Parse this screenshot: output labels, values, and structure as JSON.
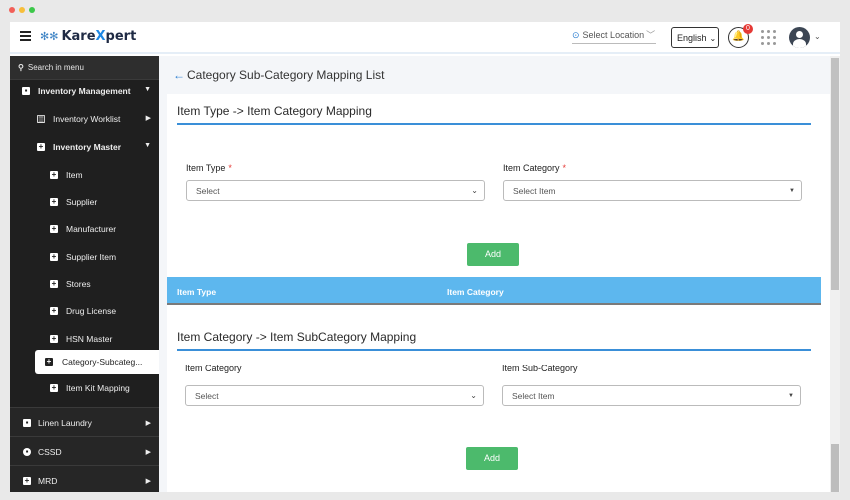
{
  "header": {
    "logo": "KareXpert",
    "logo_prefix": "Kare",
    "logo_x": "X",
    "logo_suffix": "pert",
    "location_placeholder": "Select Location",
    "language": "English",
    "notification_count": "0"
  },
  "sidebar": {
    "search_placeholder": "Search in menu",
    "items": [
      {
        "label": "Inventory Management",
        "level": 0
      },
      {
        "label": "Inventory Worklist",
        "level": 1
      },
      {
        "label": "Inventory Master",
        "level": 1
      },
      {
        "label": "Item",
        "level": 2
      },
      {
        "label": "Supplier",
        "level": 2
      },
      {
        "label": "Manufacturer",
        "level": 2
      },
      {
        "label": "Supplier Item",
        "level": 2
      },
      {
        "label": "Stores",
        "level": 2
      },
      {
        "label": "Drug License",
        "level": 2
      },
      {
        "label": "HSN Master",
        "level": 2
      },
      {
        "label": "Category-Subcateg...",
        "level": 2,
        "active": true
      },
      {
        "label": "Item Kit Mapping",
        "level": 2
      },
      {
        "label": "Linen Laundry",
        "level": 0
      },
      {
        "label": "CSSD",
        "level": 0
      },
      {
        "label": "MRD",
        "level": 0
      }
    ]
  },
  "main": {
    "page_title": "Category Sub-Category Mapping List",
    "section1": {
      "title": "Item Type -> Item Category Mapping",
      "field1_label": "Item Type",
      "field1_value": "Select",
      "field2_label": "Item Category",
      "field2_value": "Select Item",
      "add_label": "Add",
      "table_headers": [
        "Item Type",
        "Item Category"
      ]
    },
    "section2": {
      "title": "Item Category -> Item SubCategory Mapping",
      "field1_label": "Item Category",
      "field1_value": "Select",
      "field2_label": "Item Sub-Category",
      "field2_value": "Select Item",
      "add_label": "Add"
    }
  },
  "colors": {
    "sidebar_bg": "#1f1f1f",
    "accent_blue": "#3a8fd8",
    "table_header": "#5db7ee",
    "add_button": "#4cba6c",
    "required": "#e53935"
  }
}
